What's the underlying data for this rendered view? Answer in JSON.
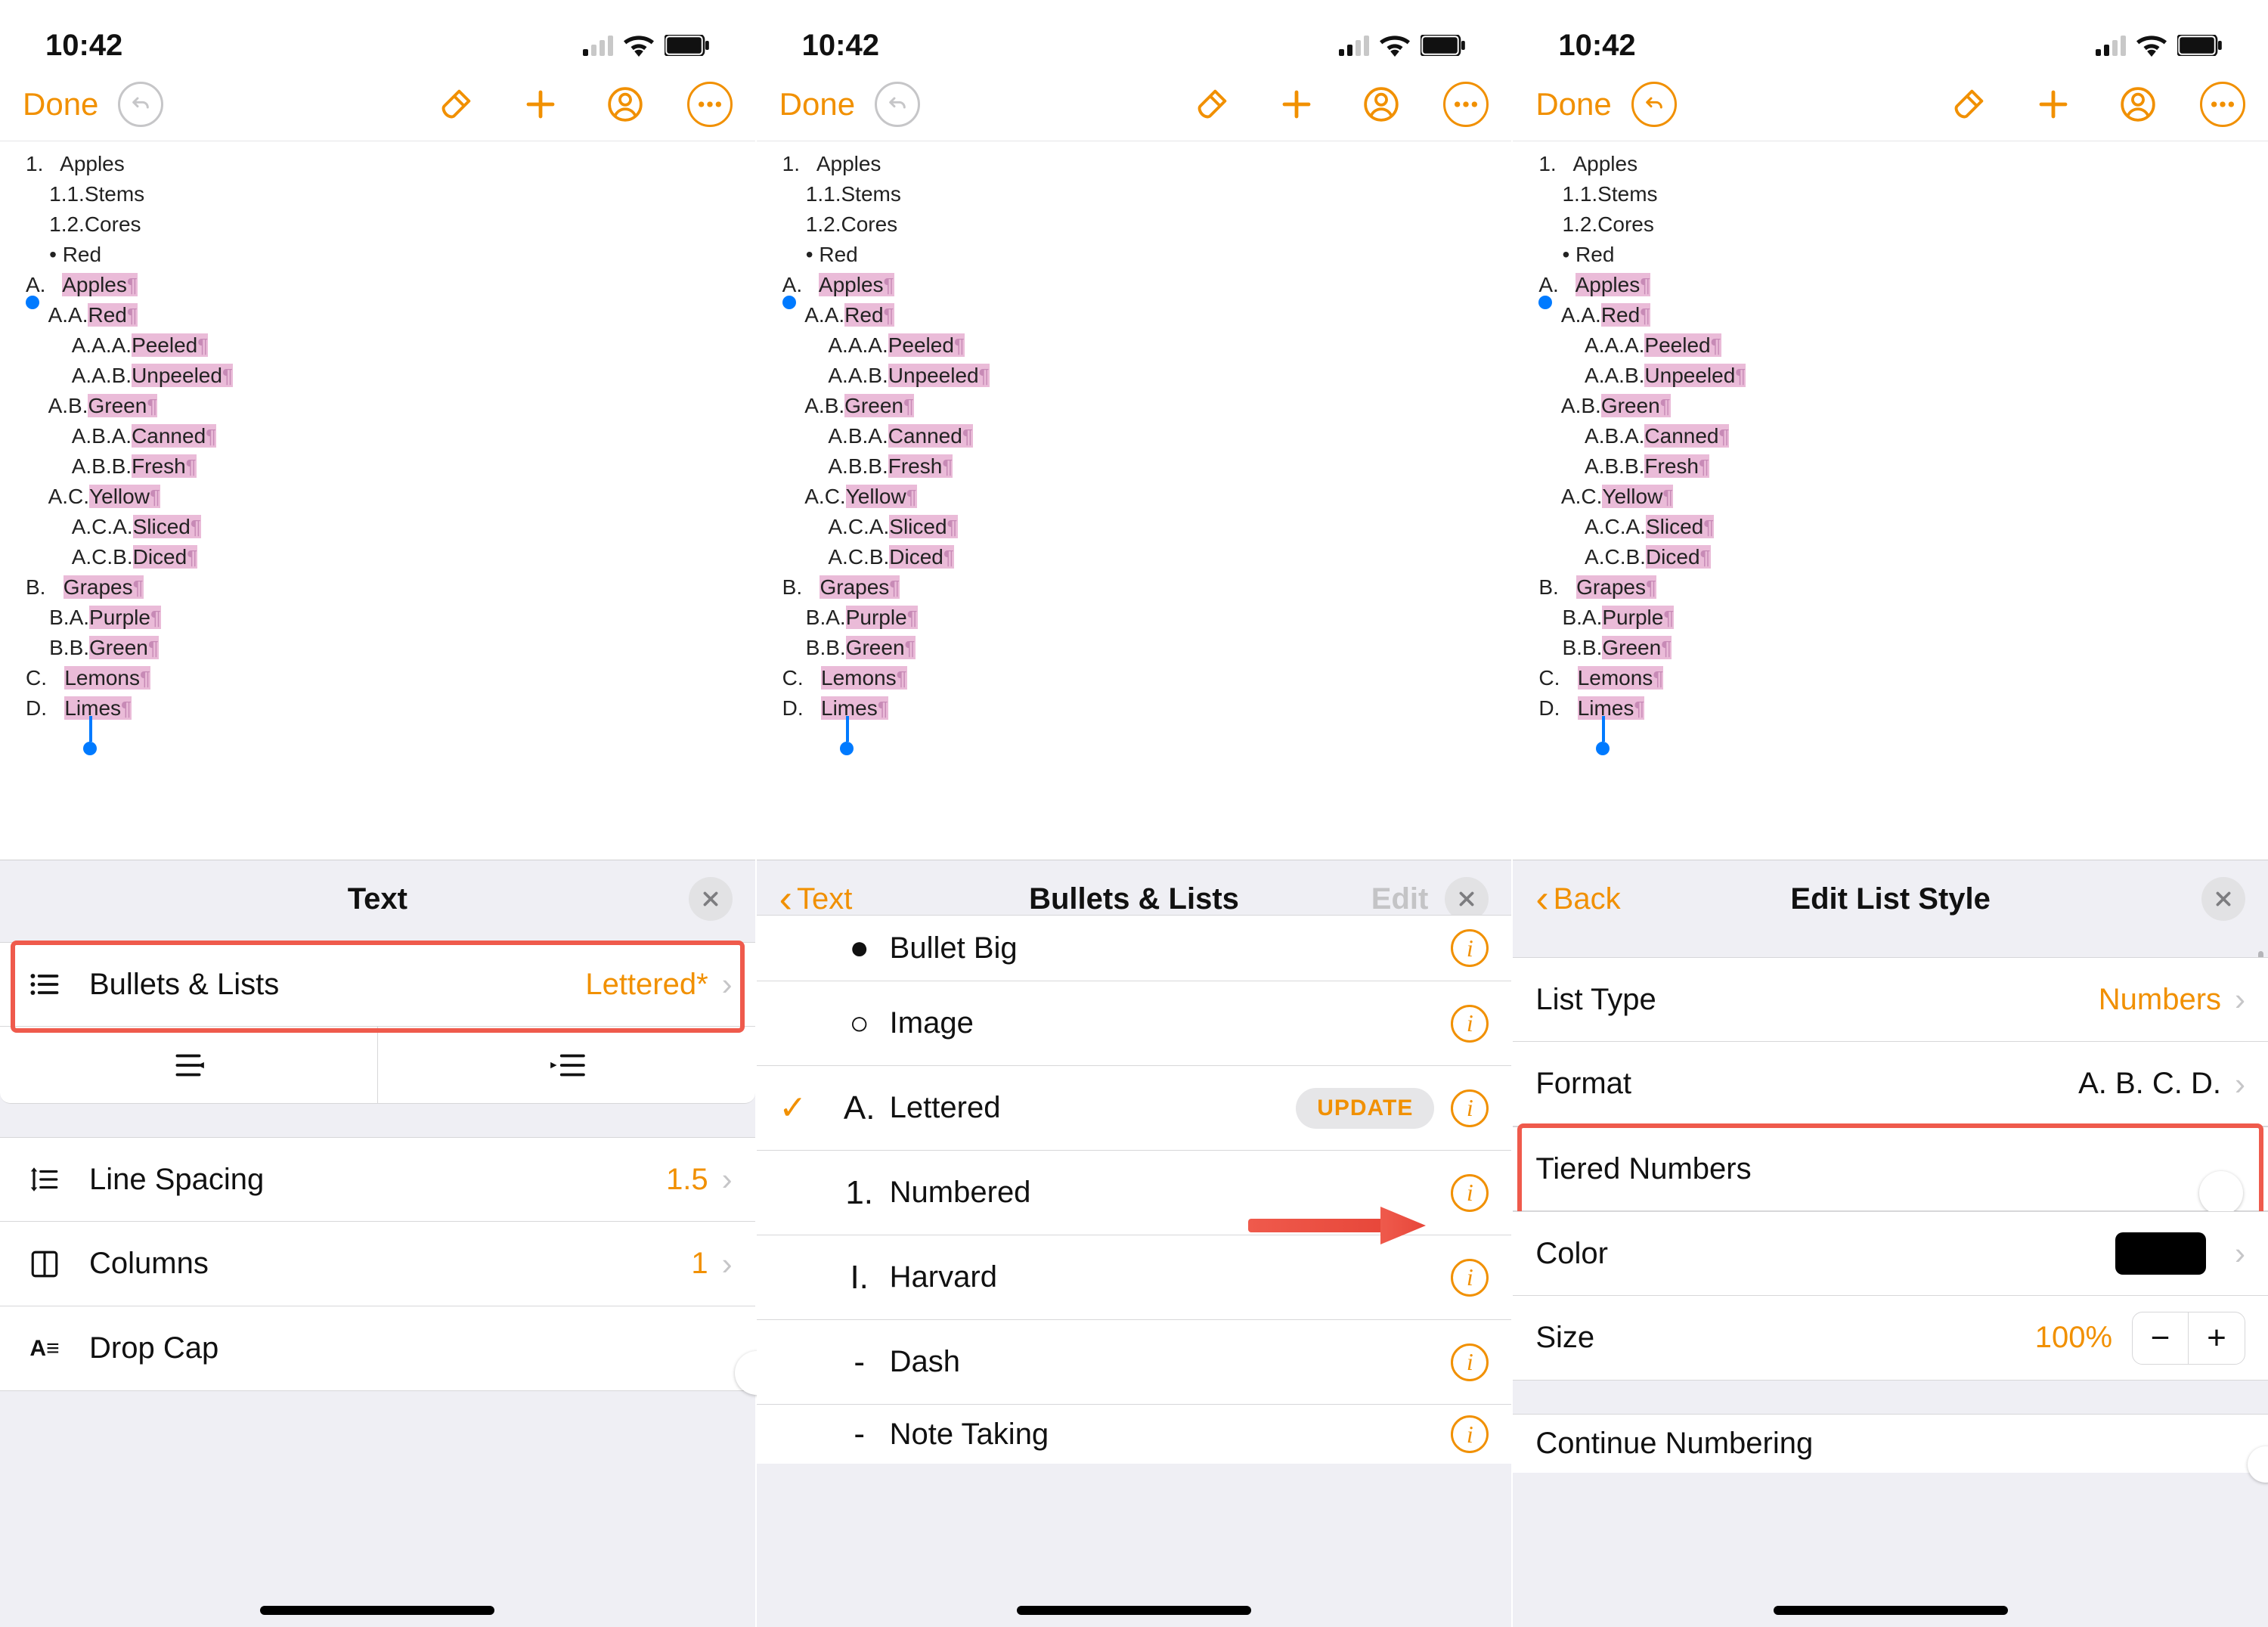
{
  "status": {
    "time": "10:42"
  },
  "toolbar": {
    "done": "Done"
  },
  "doc": {
    "l1": "1.   Apples",
    "l2": "    1.1.Stems",
    "l3": "    1.2.Cores",
    "l4": "    • Red",
    "lA": "A.   ",
    "lAv": "Apples",
    "lAA": "    A.A.",
    "lAAv": "Red",
    "lAAA": "        A.A.A.",
    "lAAAv": "Peeled",
    "lAAB": "        A.A.B.",
    "lAABv": "Unpeeled",
    "lAB": "    A.B.",
    "lABv": "Green",
    "lABA": "        A.B.A.",
    "lABAv": "Canned",
    "lABB": "        A.B.B.",
    "lABBv": "Fresh",
    "lAC": "    A.C.",
    "lACv": "Yellow",
    "lACA": "        A.C.A.",
    "lACAv": "Sliced",
    "lACB": "        A.C.B.",
    "lACBv": "Diced",
    "lB": "B.   ",
    "lBv": "Grapes",
    "lBA": "    B.A.",
    "lBAv": "Purple",
    "lBB": "    B.B.",
    "lBBv": "Green",
    "lC": "C.   ",
    "lCv": "Lemons",
    "lD": "D.   ",
    "lDv": "Limes",
    "pil": "¶"
  },
  "panel1": {
    "title": "Text",
    "bullets_label": "Bullets & Lists",
    "bullets_value": "Lettered*",
    "line_spacing_label": "Line Spacing",
    "line_spacing_value": "1.5",
    "columns_label": "Columns",
    "columns_value": "1",
    "dropcap_label": "Drop Cap"
  },
  "panel2": {
    "back": "Text",
    "title": "Bullets & Lists",
    "edit": "Edit",
    "update": "UPDATE",
    "opt_bullet_big": "Bullet Big",
    "opt_image": "Image",
    "opt_lettered": "Lettered",
    "opt_numbered": "Numbered",
    "opt_harvard": "Harvard",
    "opt_dash": "Dash",
    "opt_note": "Note Taking",
    "sym_bullet": "●",
    "sym_image": "○",
    "sym_lettered": "A.",
    "sym_numbered": "1.",
    "sym_harvard": "I.",
    "sym_dash": "-",
    "sym_note": "-"
  },
  "panel3": {
    "back": "Back",
    "title": "Edit List Style",
    "list_type_label": "List Type",
    "list_type_value": "Numbers",
    "format_label": "Format",
    "format_value": "A. B. C. D.",
    "tiered_label": "Tiered Numbers",
    "color_label": "Color",
    "size_label": "Size",
    "size_value": "100%",
    "continue_label": "Continue Numbering"
  }
}
